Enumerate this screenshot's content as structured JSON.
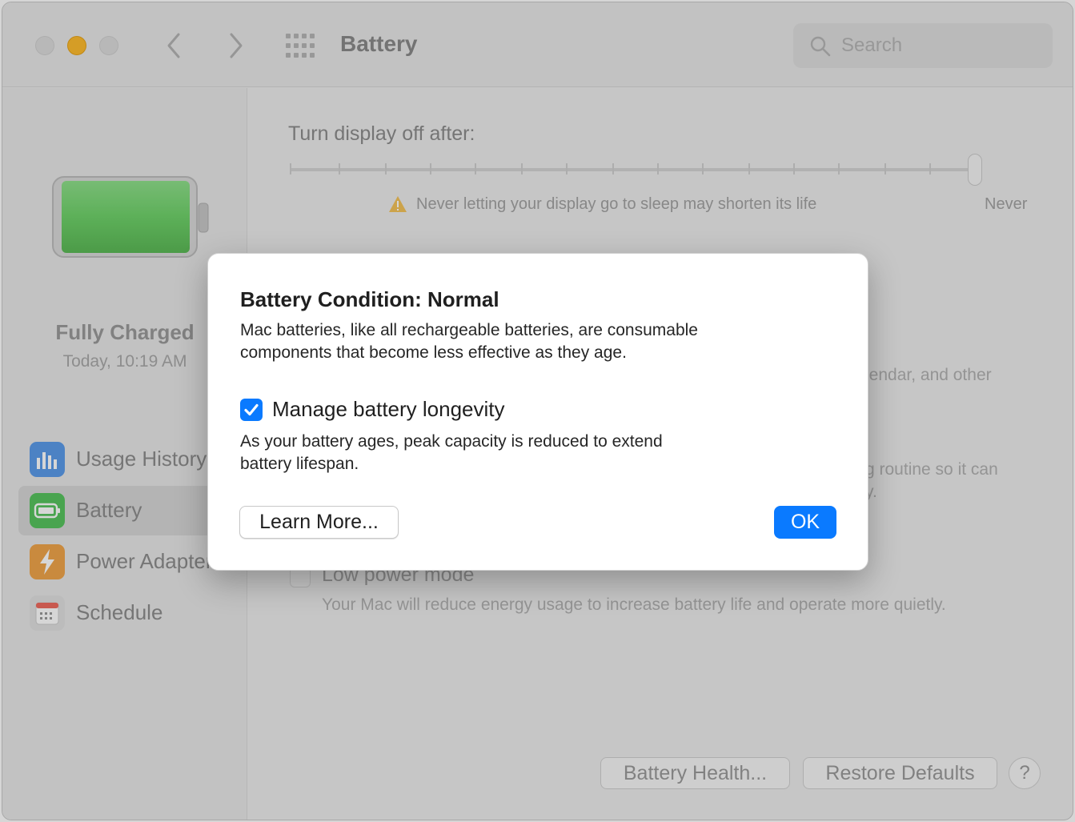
{
  "window": {
    "title": "Battery",
    "search_placeholder": "Search"
  },
  "sidebar": {
    "status_title": "Fully Charged",
    "status_time": "Today, 10:19 AM",
    "items": [
      {
        "label": "Usage History",
        "icon": "bar-chart-icon",
        "color": "#5b9bea"
      },
      {
        "label": "Battery",
        "icon": "battery-icon",
        "color": "#57c45f",
        "selected": true
      },
      {
        "label": "Power Adapter",
        "icon": "lightning-bolt-icon",
        "color": "#f0a54a"
      },
      {
        "label": "Schedule",
        "icon": "calendar-icon",
        "color": "#e1e1e1"
      }
    ]
  },
  "main": {
    "display_label": "Turn display off after:",
    "slider_value": "Never",
    "warning_text": "Never letting your display go to sleep may shorten its life",
    "partial_text_1": "lendar, and other",
    "partial_text_2": "g routine so it can",
    "partial_text_3": "y.",
    "low_power_label": "Low power mode",
    "low_power_desc": "Your Mac will reduce energy usage to increase battery life and operate more quietly.",
    "battery_health_button": "Battery Health...",
    "restore_defaults_button": "Restore Defaults",
    "help_button": "?"
  },
  "dialog": {
    "title": "Battery Condition: Normal",
    "body_line_1": "Mac batteries, like all rechargeable batteries, are consumable",
    "body_line_2": "components that become less effective as they age.",
    "checkbox_label": "Manage battery longevity",
    "checkbox_checked": true,
    "note_line_1": "As your battery ages, peak capacity is reduced to extend",
    "note_line_2": "battery lifespan.",
    "learn_more_button": "Learn More...",
    "ok_button": "OK"
  },
  "colors": {
    "accent": "#0a7aff",
    "battery_green": "#6fd26a",
    "minimize_yellow": "#febc2e"
  }
}
